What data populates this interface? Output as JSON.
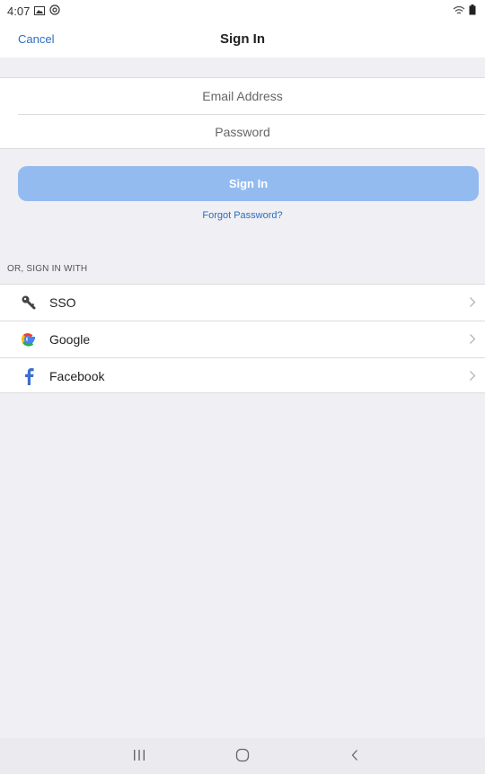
{
  "status_bar": {
    "time": "4:07",
    "icons": [
      "image-icon",
      "at-icon",
      "wifi-icon",
      "battery-icon"
    ]
  },
  "header": {
    "cancel_label": "Cancel",
    "title": "Sign In"
  },
  "form": {
    "email_placeholder": "Email Address",
    "password_placeholder": "Password",
    "signin_label": "Sign In",
    "forgot_label": "Forgot Password?"
  },
  "alt_signin": {
    "section_label": "OR, SIGN IN WITH",
    "providers": [
      {
        "label": "SSO",
        "icon": "key-icon"
      },
      {
        "label": "Google",
        "icon": "google-icon"
      },
      {
        "label": "Facebook",
        "icon": "facebook-icon"
      }
    ]
  },
  "system_nav": {
    "buttons": [
      "recent-apps-icon",
      "home-icon",
      "back-icon"
    ]
  },
  "colors": {
    "accent": "#2d6ebd",
    "button_disabled": "#93bbef",
    "background": "#efeff4",
    "facebook": "#3b6fd0"
  }
}
